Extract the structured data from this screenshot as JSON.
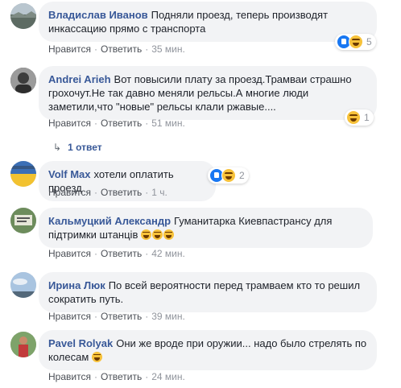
{
  "comments": [
    {
      "author": "Владислав Иванов",
      "text": "Подняли проезд, теперь производят инкассацию прямо с транспорта",
      "like_label": "Нравится",
      "reply_label": "Ответить",
      "time": "35 мин.",
      "reaction_count": "5",
      "reactions": [
        "like",
        "haha"
      ],
      "avatar": "landscape-photo"
    },
    {
      "author": "Andrei Arieh",
      "text": "Вот повысили плату за проезд.Трамваи страшно грохочут.Не так давно меняли рельсы.А многие люди заметили,что \"новые\" рельсы клали ржавые....",
      "like_label": "Нравится",
      "reply_label": "Ответить",
      "time": "51 мин.",
      "reaction_count": "1",
      "reactions": [
        "haha"
      ],
      "replies_label": "1 ответ",
      "avatar": "portrait-photo"
    },
    {
      "author": "Volf Max",
      "text": "хотели оплатить проезд",
      "like_label": "Нравится",
      "reply_label": "Ответить",
      "time": "1 ч.",
      "reaction_count": "2",
      "reactions": [
        "like",
        "haha"
      ],
      "avatar": "flag-photo"
    },
    {
      "author": "Кальмуцкий Александр",
      "text": "Гуманитарка Киевпастрансу для підтримки штанців",
      "emoji": [
        "grin-emoji",
        "grin-emoji",
        "grin-emoji"
      ],
      "like_label": "Нравится",
      "reply_label": "Ответить",
      "time": "42 мин.",
      "avatar": "sign-photo"
    },
    {
      "author": "Ирина Люк",
      "text": "По всей вероятности перед трамваем кто то решил сократить путь.",
      "like_label": "Нравится",
      "reply_label": "Ответить",
      "time": "39 мин.",
      "avatar": "sky-photo"
    },
    {
      "author": "Pavel Rolyak",
      "text": "Они же вроде при оружии... надо было стрелять по колесам",
      "emoji": [
        "grin-emoji"
      ],
      "like_label": "Нравится",
      "reply_label": "Ответить",
      "time": "24 мин.",
      "avatar": "outdoor-photo"
    }
  ],
  "colors": {
    "author": "#385898",
    "bubble": "#f2f3f5",
    "meta": "#90949c",
    "like": "#1877f2",
    "haha": "#f7c23a"
  }
}
